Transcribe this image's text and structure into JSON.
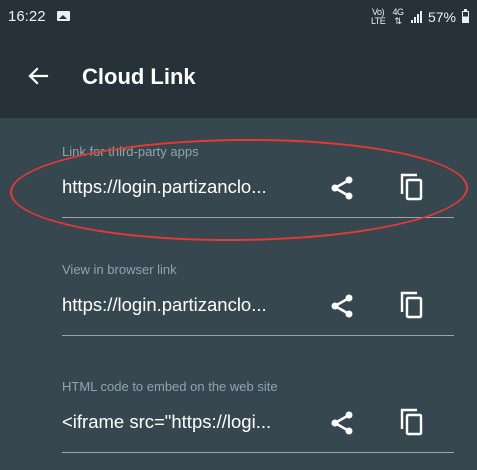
{
  "status_bar": {
    "time": "16:22",
    "gallery_icon": "image-icon",
    "network_label": "Vo) 4G LTE",
    "battery_percent": "57%"
  },
  "app_bar": {
    "back_icon": "arrow-left-icon",
    "title": "Cloud Link"
  },
  "links": [
    {
      "label": "Link for third-party apps",
      "value": "https://login.partizanclo...",
      "share_icon": "share-icon",
      "copy_icon": "copy-icon"
    },
    {
      "label": "View in browser link",
      "value": "https://login.partizanclo...",
      "share_icon": "share-icon",
      "copy_icon": "copy-icon"
    },
    {
      "label": "HTML code to embed on the web site",
      "value": "<iframe src=\"https://logi...",
      "share_icon": "share-icon",
      "copy_icon": "copy-icon"
    }
  ],
  "colors": {
    "app_bar": "#263238",
    "background": "#37474f",
    "label": "#90a4ae",
    "annotation": "#e53935"
  }
}
